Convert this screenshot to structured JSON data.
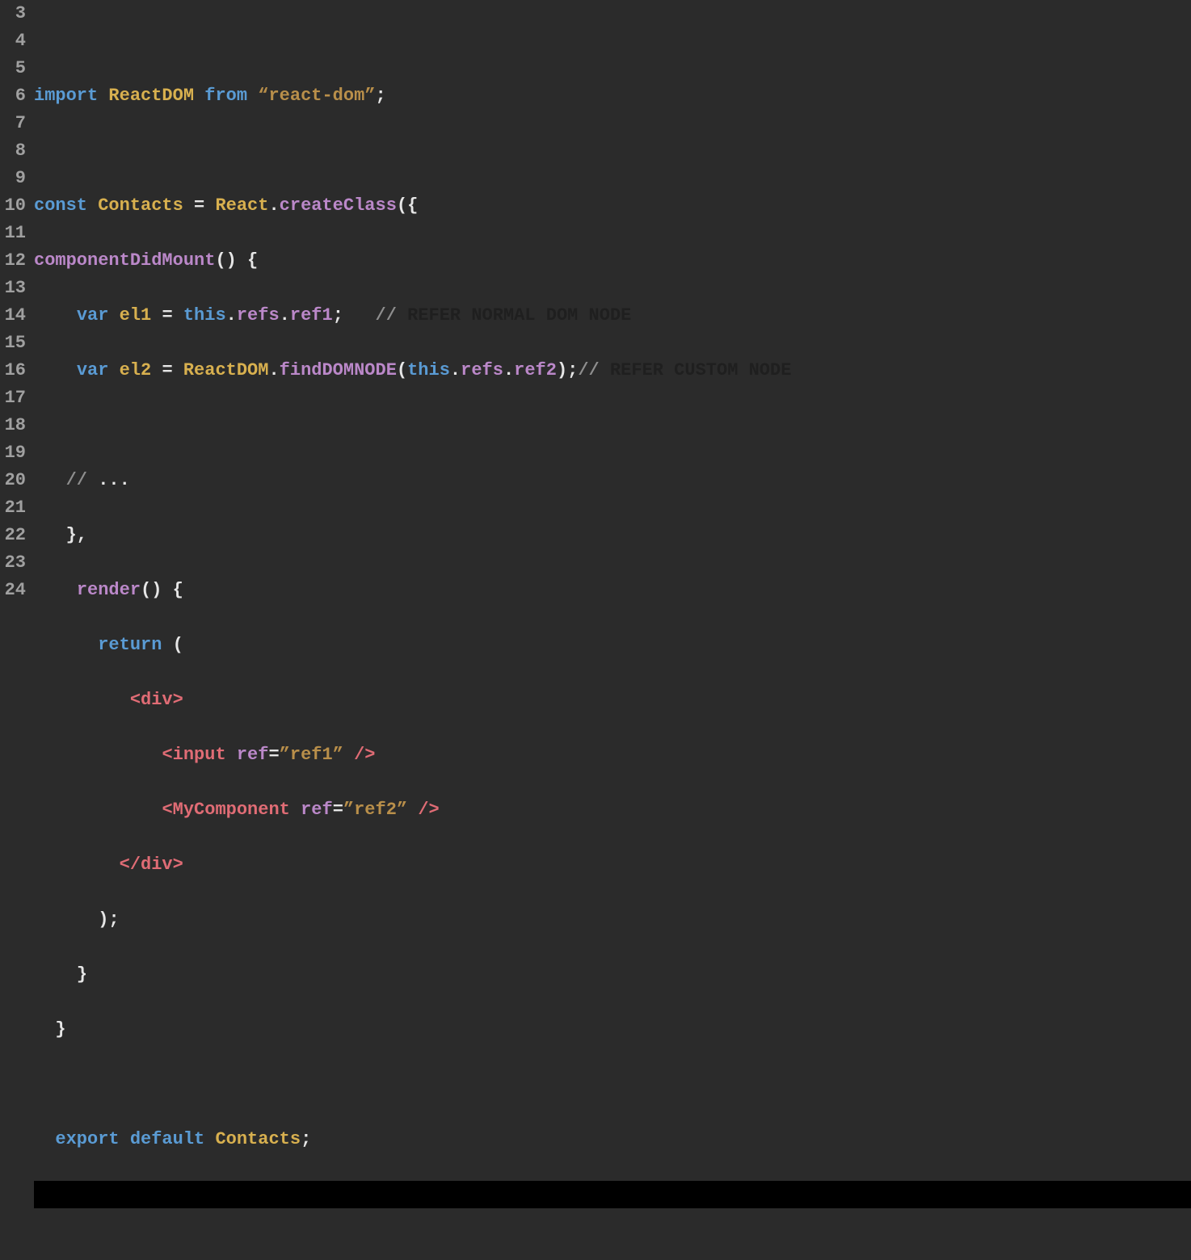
{
  "gutter": {
    "start": 3,
    "end": 24
  },
  "colors": {
    "bg": "#2b2b2b",
    "keyword": "#5a9bd4",
    "ident": "#d8b04f",
    "string": "#b98f4a",
    "comment": "#1f1f1f",
    "prop": "#bb88c9",
    "tag": "#e06c75"
  },
  "code": {
    "l3": "",
    "l4": {
      "kw_import": "import",
      "name": "ReactDOM",
      "kw_from": "from",
      "str": "“react-dom”",
      "semi": ";"
    },
    "l5": "",
    "l6": {
      "kw_const": "const",
      "name": "Contacts",
      "eq": "=",
      "react": "React",
      "dot": ".",
      "method": "createClass",
      "open": "({"
    },
    "l7": {
      "method": "componentDidMount",
      "parens": "()",
      "brace": "{"
    },
    "l8": {
      "kw_var": "var",
      "name": "el1",
      "eq": "=",
      "this": "this",
      "d1": ".",
      "refs": "refs",
      "d2": ".",
      "ref": "ref1",
      "semi": ";",
      "slashes": "//",
      "cmt": " REFER NORMAL DOM NODE"
    },
    "l9": {
      "kw_var": "var",
      "name": "el2",
      "eq": "=",
      "cls": "ReactDOM",
      "d1": ".",
      "method": "findDOMNODE",
      "op": "(",
      "this": "this",
      "d2": ".",
      "refs": "refs",
      "d3": ".",
      "ref": "ref2",
      "cp": ")",
      "semi": ";",
      "slashes": "//",
      "cmt": " REFER CUSTOM NODE"
    },
    "l10": "",
    "l11": {
      "slashes": "//",
      "cmt": " ..."
    },
    "l12": {
      "close": "},"
    },
    "l13": {
      "method": "render",
      "parens": "()",
      "brace": "{"
    },
    "l14": {
      "kw": "return",
      "open": "("
    },
    "l15": {
      "lt": "<",
      "tag": "div",
      "gt": ">"
    },
    "l16": {
      "lt": "<",
      "tag": "input",
      "attr": "ref",
      "eq": "=",
      "val": "”ref1”",
      "close": "/>"
    },
    "l17": {
      "lt": "<",
      "tag": "MyComponent",
      "attr": "ref",
      "eq": "=",
      "val": "”ref2”",
      "close": "/>"
    },
    "l18": {
      "lt": "</",
      "tag": "div",
      "gt": ">"
    },
    "l19": {
      "close": ");"
    },
    "l20": {
      "brace": "}"
    },
    "l21": {
      "brace": "}"
    },
    "l22": "",
    "l23": {
      "kw_export": "export",
      "kw_default": "default",
      "name": "Contacts",
      "semi": ";"
    },
    "l24": ""
  }
}
